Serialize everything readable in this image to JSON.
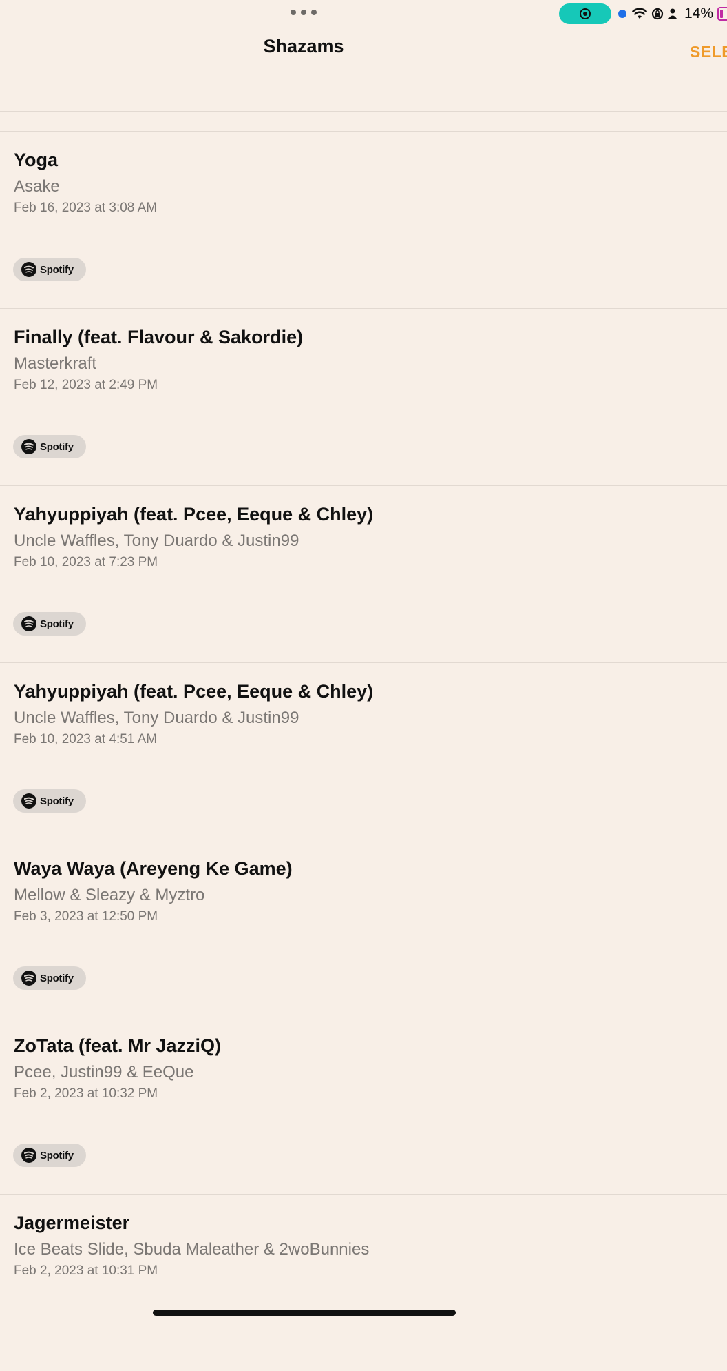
{
  "status_bar": {
    "battery_percent": "14%",
    "battery_color": "#c02ba4",
    "recording_color": "#16c8b8"
  },
  "nav": {
    "title": "Shazams",
    "select_label": "SELECT"
  },
  "accent_color": "#ef9a2a",
  "items": [
    {
      "title": "Yoga",
      "artist": "Asake",
      "date": "Feb 16, 2023 at 3:08 AM",
      "service": "Spotify"
    },
    {
      "title": "Finally (feat. Flavour & Sakordie)",
      "artist": "Masterkraft",
      "date": "Feb 12, 2023 at 2:49 PM",
      "service": "Spotify"
    },
    {
      "title": "Yahyuppiyah (feat. Pcee, Eeque & Chley)",
      "artist": "Uncle Waffles, Tony Duardo & Justin99",
      "date": "Feb 10, 2023 at 7:23 PM",
      "service": "Spotify"
    },
    {
      "title": "Yahyuppiyah (feat. Pcee, Eeque & Chley)",
      "artist": "Uncle Waffles, Tony Duardo & Justin99",
      "date": "Feb 10, 2023 at 4:51 AM",
      "service": "Spotify"
    },
    {
      "title": "Waya Waya (Areyeng Ke Game)",
      "artist": "Mellow & Sleazy & Myztro",
      "date": "Feb 3, 2023 at 12:50 PM",
      "service": "Spotify"
    },
    {
      "title": "ZoTata (feat. Mr JazziQ)",
      "artist": "Pcee, Justin99 & EeQue",
      "date": "Feb 2, 2023 at 10:32 PM",
      "service": "Spotify"
    },
    {
      "title": "Jagermeister",
      "artist": "Ice Beats Slide, Sbuda Maleather & 2woBunnies",
      "date": "Feb 2, 2023 at 10:31 PM",
      "service": "Spotify"
    }
  ]
}
